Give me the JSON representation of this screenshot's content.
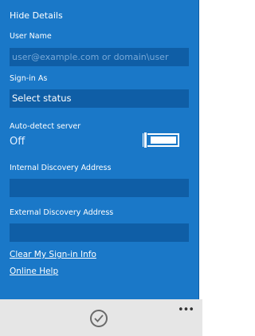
{
  "hide_details_label": "Hide Details",
  "user_name": {
    "label": "User Name",
    "value": "",
    "placeholder": "user@example.com or domain\\user"
  },
  "sign_in_as": {
    "label": "Sign-in As",
    "value": "Select status"
  },
  "auto_detect": {
    "label": "Auto-detect server",
    "state_text": "Off",
    "enabled": false
  },
  "internal_discovery": {
    "label": "Internal Discovery Address",
    "value": ""
  },
  "external_discovery": {
    "label": "External Discovery Address",
    "value": ""
  },
  "links": {
    "clear_sign_in": "Clear My Sign-in Info",
    "online_help": "Online Help"
  },
  "app_bar": {
    "done_icon": "checkmark-circle-icon",
    "more_label": "•••"
  },
  "colors": {
    "panel": "#1a78c8",
    "field": "#0f5ea6",
    "app_bar": "#e6e6e6"
  }
}
